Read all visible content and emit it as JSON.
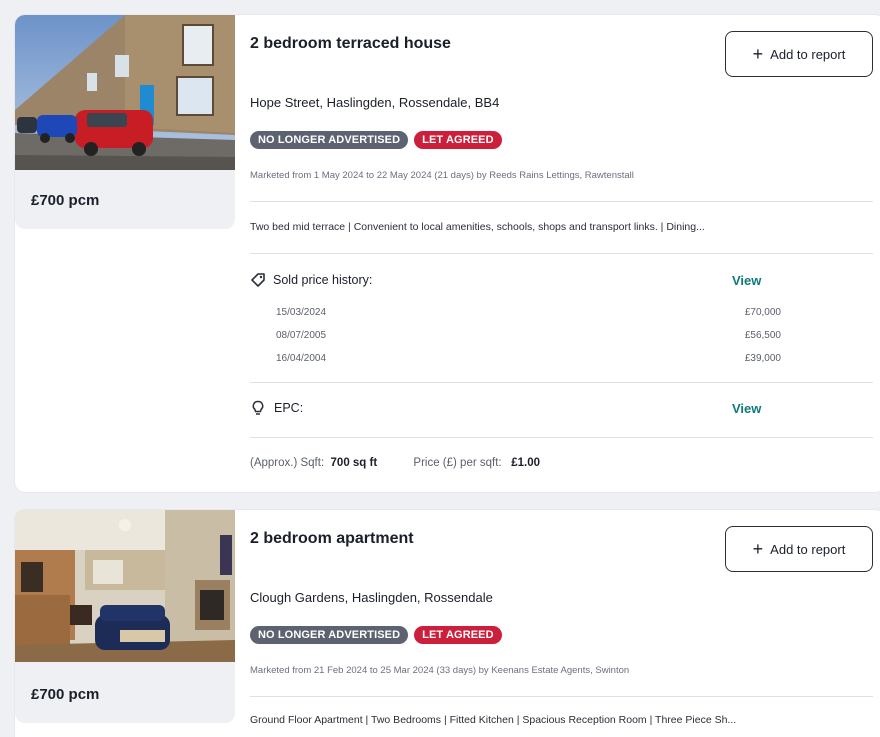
{
  "listings": [
    {
      "title": "2 bedroom terraced house",
      "price": "£700 pcm",
      "address": "Hope Street, Haslingden, Rossendale, BB4",
      "badges": [
        "NO LONGER ADVERTISED",
        "LET AGREED"
      ],
      "marketed": "Marketed from 1 May 2024 to 22 May 2024 (21 days) by Reeds Rains Lettings, Rawtenstall",
      "description": "Two bed mid terrace | Convenient to local amenities, schools, shops and transport links. | Dining...",
      "add_button": "Add to report",
      "sold_history": {
        "label": "Sold price history:",
        "view_label": "View",
        "rows": [
          {
            "date": "15/03/2024",
            "price": "£70,000"
          },
          {
            "date": "08/07/2005",
            "price": "£56,500"
          },
          {
            "date": "16/04/2004",
            "price": "£39,000"
          }
        ]
      },
      "epc": {
        "label": "EPC:",
        "view_label": "View"
      },
      "sqft": {
        "label": "(Approx.) Sqft:",
        "value": "700 sq ft",
        "price_label": "Price (£) per sqft:",
        "price_value": "£1.00"
      }
    },
    {
      "title": "2 bedroom apartment",
      "price": "£700 pcm",
      "address": "Clough Gardens, Haslingden, Rossendale",
      "badges": [
        "NO LONGER ADVERTISED",
        "LET AGREED"
      ],
      "marketed": "Marketed from 21 Feb 2024 to 25 Mar 2024 (33 days) by Keenans Estate Agents, Swinton",
      "description": "Ground Floor Apartment | Two Bedrooms | Fitted Kitchen | Spacious Reception Room | Three Piece Sh...",
      "add_button": "Add to report"
    }
  ],
  "colors": {
    "badge_grey": "#5d6270",
    "badge_red": "#cc1f3c",
    "link_teal": "#0f7a7a"
  },
  "icons": {
    "sold_history": "tag-icon",
    "epc": "lightbulb-icon",
    "add": "plus-icon"
  }
}
